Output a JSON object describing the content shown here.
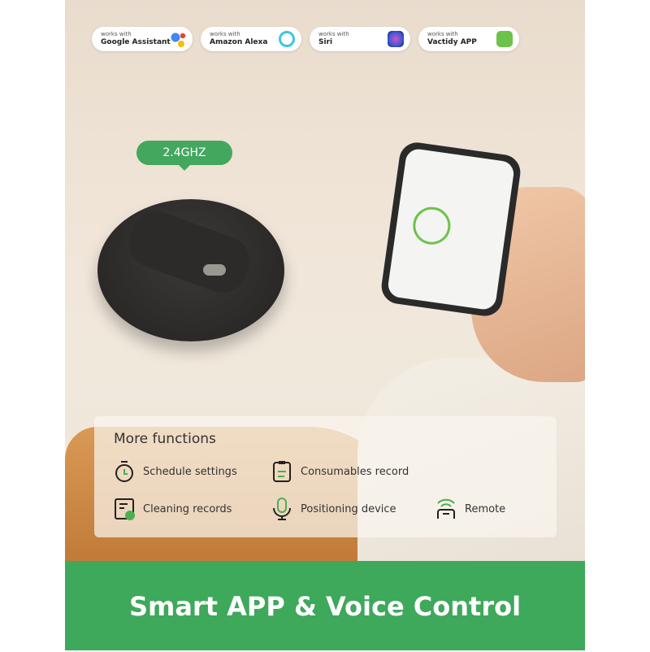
{
  "badges": [
    {
      "small": "works with",
      "name": "Google Assistant",
      "icon": "google-assistant-icon"
    },
    {
      "small": "works with",
      "name": "Amazon Alexa",
      "icon": "alexa-icon"
    },
    {
      "small": "works with",
      "name": "Siri",
      "icon": "siri-icon"
    },
    {
      "small": "works with",
      "name": "Vactidy APP",
      "icon": "vactidy-app-icon"
    }
  ],
  "wifi_label": "2.4GHZ",
  "functions": {
    "title": "More functions",
    "items": [
      {
        "label": "Schedule settings",
        "icon": "timer-icon"
      },
      {
        "label": "Consumables record",
        "icon": "clipboard-icon"
      },
      {
        "label": "Cleaning records",
        "icon": "record-clock-icon"
      },
      {
        "label": "Positioning device",
        "icon": "microphone-icon"
      },
      {
        "label": "Remote",
        "icon": "remote-icon"
      }
    ]
  },
  "banner": "Smart APP & Voice Control",
  "colors": {
    "accent": "#3ea85b"
  }
}
